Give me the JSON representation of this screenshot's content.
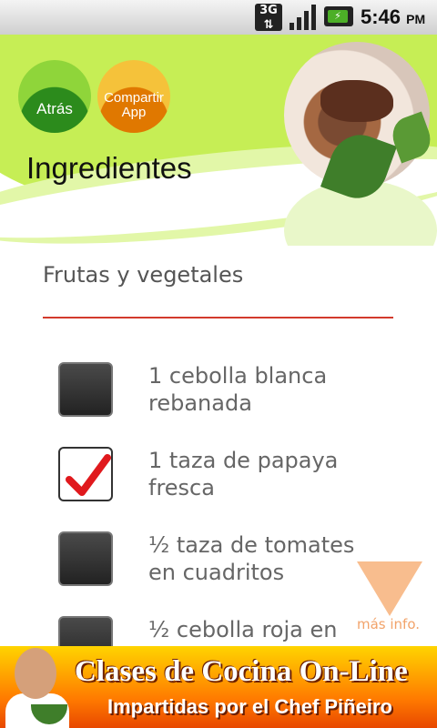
{
  "status_bar": {
    "network": "3G",
    "time": "5:46",
    "ampm": "PM"
  },
  "header": {
    "back_label": "Atrás",
    "share_label": "Compartir App",
    "title": "Ingredientes"
  },
  "section": {
    "title": "Frutas y vegetales"
  },
  "ingredients": [
    {
      "label": "1 cebolla blanca rebanada",
      "checked": false
    },
    {
      "label": "1 taza de papaya fresca",
      "checked": true
    },
    {
      "label": "½ taza de tomates en cuadritos",
      "checked": false
    },
    {
      "label": "½ cebolla roja en",
      "checked": false
    }
  ],
  "more_info": {
    "label": "más info."
  },
  "banner": {
    "title": "Clases de Cocina On-Line",
    "subtitle": "Impartidas por el Chef Piñeiro"
  },
  "colors": {
    "header_green": "#c6ee55",
    "divider_red": "#d33a2c",
    "banner_orange": "#ff7a00"
  }
}
